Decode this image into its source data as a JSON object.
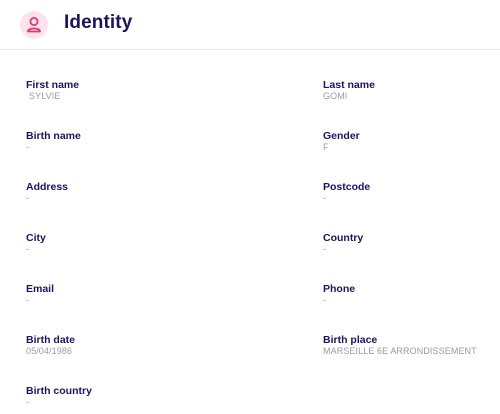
{
  "header": {
    "title": "Identity",
    "icon": "user-icon",
    "icon_color": "#e8336e",
    "icon_bg": "#fde4ec",
    "title_color": "#1a1464"
  },
  "fields": {
    "first_name": {
      "label": "First name",
      "value": "SYLVIE"
    },
    "last_name": {
      "label": "Last name",
      "value": "GOMI"
    },
    "birth_name": {
      "label": "Birth name",
      "value": "-"
    },
    "gender": {
      "label": "Gender",
      "value": "F"
    },
    "address": {
      "label": "Address",
      "value": "-"
    },
    "postcode": {
      "label": "Postcode",
      "value": "-"
    },
    "city": {
      "label": "City",
      "value": "-"
    },
    "country": {
      "label": "Country",
      "value": "-"
    },
    "email": {
      "label": "Email",
      "value": "-"
    },
    "phone": {
      "label": "Phone",
      "value": "-"
    },
    "birth_date": {
      "label": "Birth date",
      "value": "05/04/1986"
    },
    "birth_place": {
      "label": "Birth place",
      "value": "MARSEILLE 6E ARRONDISSEMENT"
    },
    "birth_country": {
      "label": "Birth country",
      "value": "-"
    }
  }
}
